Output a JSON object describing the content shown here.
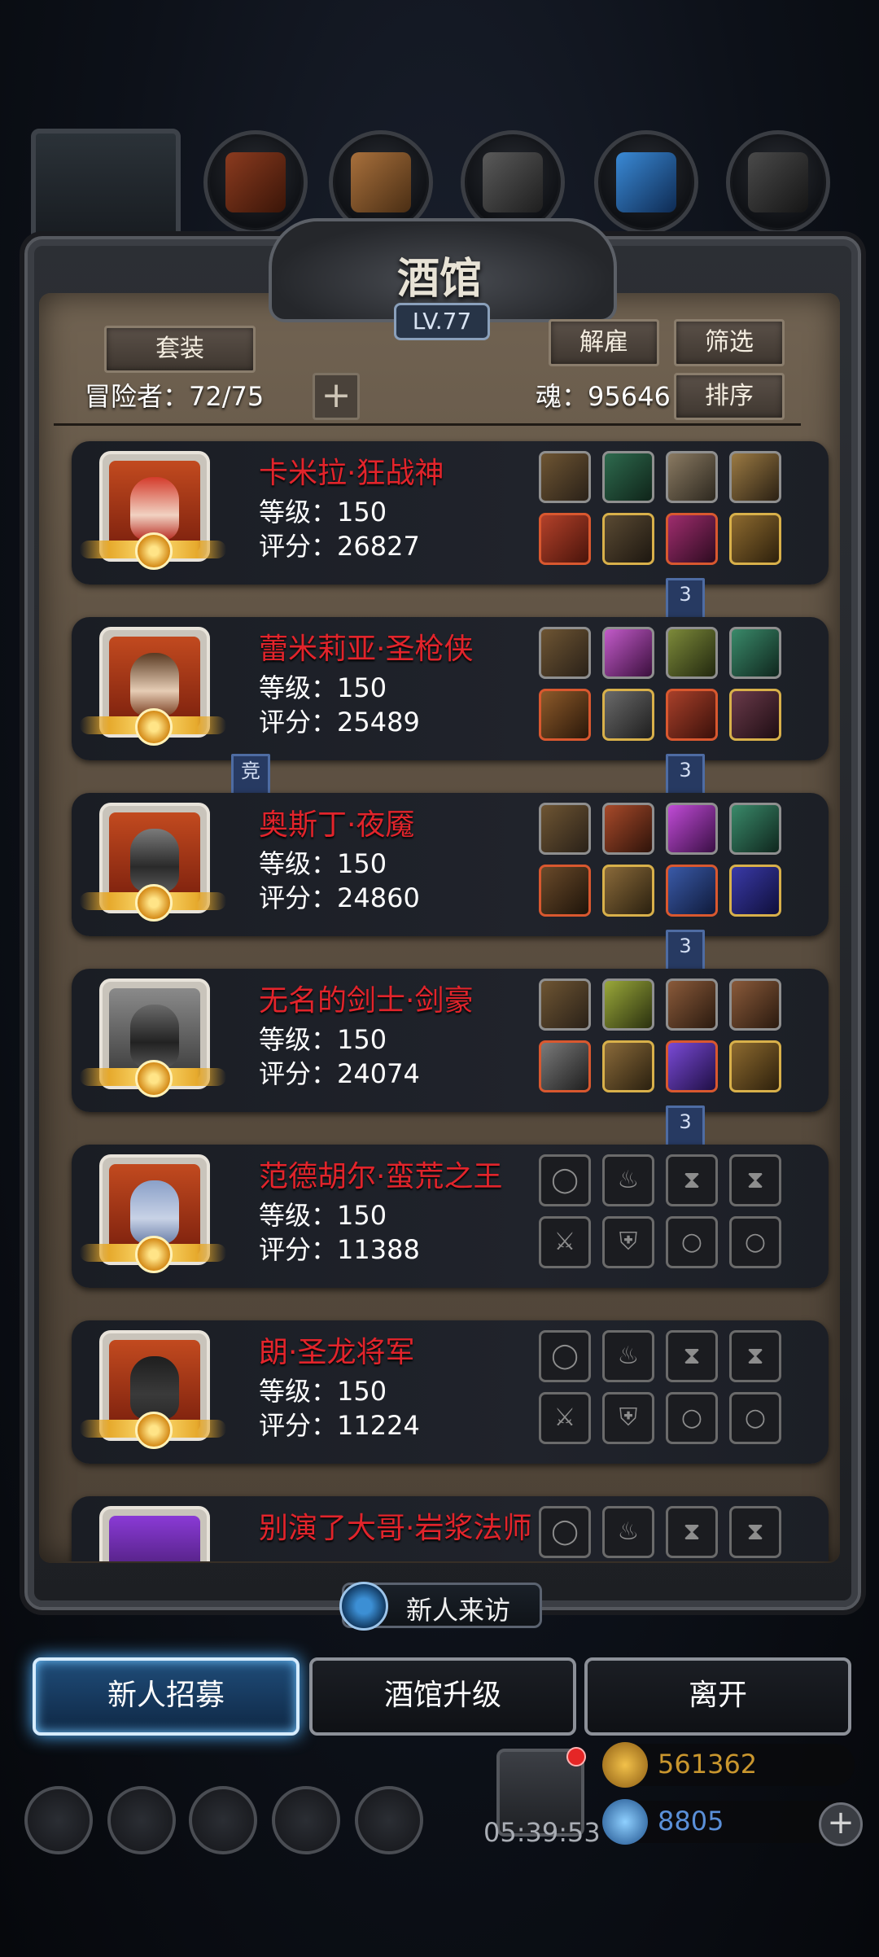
{
  "header": {
    "title": "酒馆",
    "level_badge": "LV.77"
  },
  "toolbar": {
    "suit_label": "套装",
    "dismiss_label": "解雇",
    "filter_label": "筛选",
    "sort_label": "排序",
    "adventurers": "冒险者：72/75",
    "soul": "魂：95646",
    "add_label": "+"
  },
  "heroes": [
    {
      "name": "卡米拉·狂战神",
      "level": "等级：150",
      "score": "评分：26827",
      "tier_badge": "3"
    },
    {
      "name": "蕾米莉亚·圣枪侠",
      "level": "等级：150",
      "score": "评分：25489",
      "tier_badge": "3",
      "arena_badge": "竞"
    },
    {
      "name": "奥斯丁·夜魇",
      "level": "等级：150",
      "score": "评分：24860",
      "tier_badge": "3"
    },
    {
      "name": "无名的剑士·剑豪",
      "level": "等级：150",
      "score": "评分：24074",
      "tier_badge": "3"
    },
    {
      "name": "范德胡尔·蛮荒之王",
      "level": "等级：150",
      "score": "评分：11388"
    },
    {
      "name": "朗·圣龙将军",
      "level": "等级：150",
      "score": "评分：11224"
    },
    {
      "name": "别演了大哥·岩浆法师"
    }
  ],
  "bottom": {
    "new_visit": "新人来访",
    "recruit": "新人招募",
    "upgrade": "酒馆升级",
    "leave": "离开",
    "timer": "05:39:53",
    "gold": "561362",
    "gems": "8805",
    "add_label": "+"
  },
  "colors": {
    "hero_name": "#e2242b",
    "gold_text": "#c9962e",
    "gem_text": "#5a8fd8",
    "active_button_glow": "#4fb1ff"
  }
}
